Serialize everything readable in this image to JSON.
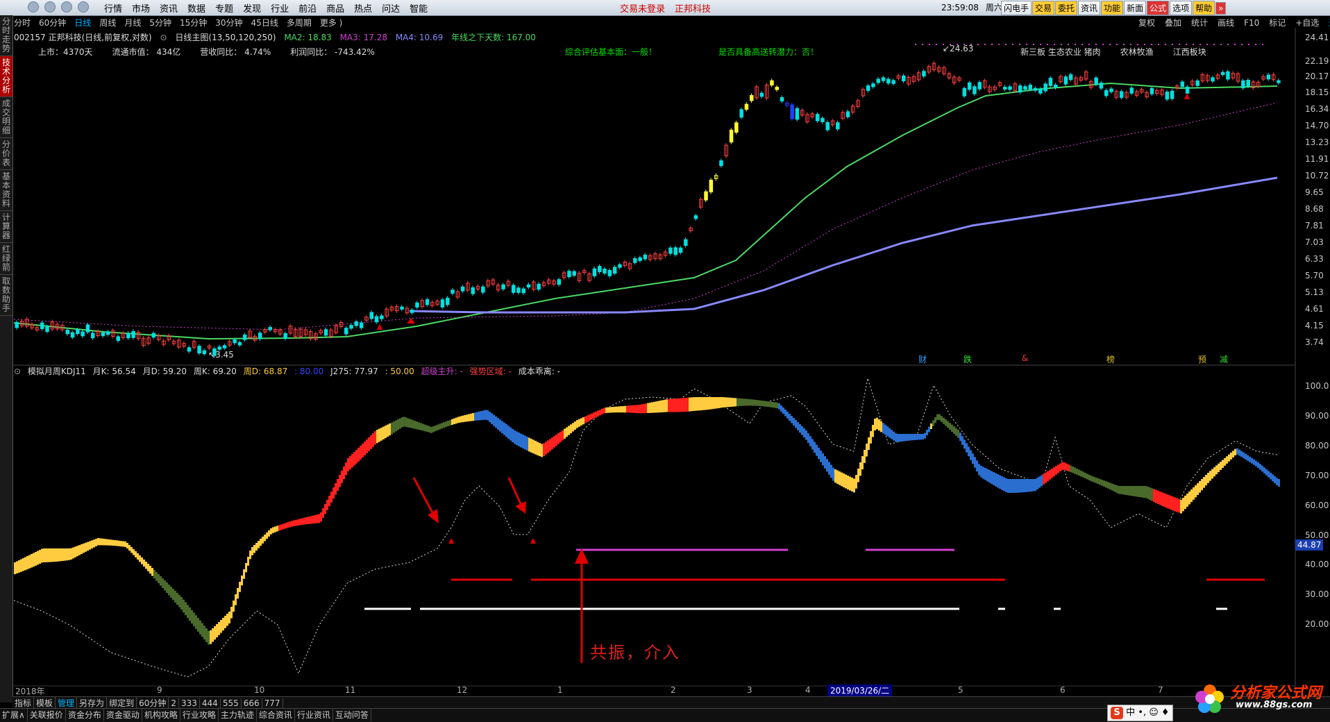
{
  "menu": [
    "行情",
    "市场",
    "资讯",
    "数据",
    "专题",
    "发现",
    "行业",
    "前沿",
    "商品",
    "热点",
    "问达",
    "智能"
  ],
  "status": {
    "trade": "交易未登录",
    "stock": "正邦科技"
  },
  "clock": {
    "time": "23:59:08",
    "weekday": "周六"
  },
  "top_buttons": [
    "闪电手",
    "交易",
    "委托",
    "资讯",
    "功能",
    "新面",
    "公式",
    "选项",
    "帮助"
  ],
  "side_tabs": [
    "分时走势",
    "技术分析",
    "成交明细",
    "分价表",
    "基本资料",
    "计算器",
    "红绿箭",
    "取数助手"
  ],
  "periods": [
    "分时",
    "60分钟",
    "日线",
    "周线",
    "月线",
    "5分钟",
    "15分钟",
    "30分钟",
    "45日线",
    "多周期",
    "更多 )"
  ],
  "active_period": "日线",
  "right_tools": [
    "复权",
    "叠加",
    "统计",
    "画线",
    "F10",
    "标记",
    "+自选",
    "返回"
  ],
  "info": {
    "code_name": "002157 正邦科技(日线,前复权,对数)",
    "main_chart": "日线主图(13,50,120,250)",
    "ma2": "MA2: 18.83",
    "ma3": "MA3: 17.28",
    "ma4": "MA4: 10.69",
    "year_line": "年线之下天数: 167.00"
  },
  "stats": [
    "上市：4370天",
    "流通市值：   434亿",
    "营收同比：   4.74%",
    "利润同比：   -743.42%"
  ],
  "evaluation": {
    "basic": "综合评估基本面：一般！",
    "potential": "是否具备高送转潜力：否！"
  },
  "sectors": [
    "新三板 生态农业 猪肉",
    "农林牧渔",
    "江西板块"
  ],
  "price_axis": [
    "24.41",
    "22.19",
    "20.17",
    "18.15",
    "16.34",
    "14.70",
    "13.23",
    "11.91",
    "10.72",
    "9.65",
    "8.68",
    "7.81",
    "7.03",
    "6.33",
    "5.70",
    "5.13",
    "4.61",
    "4.15",
    "3.74"
  ],
  "price_labels": {
    "high": "24.63",
    "low": "3.45"
  },
  "event_labels": [
    {
      "text": "财",
      "color": "#3aa0ff"
    },
    {
      "text": "跌",
      "color": "#30e030"
    },
    {
      "text": "&",
      "color": "#ff3030"
    },
    {
      "text": "榜",
      "color": "#e0c020"
    },
    {
      "text": "预",
      "color": "#e0c020"
    },
    {
      "text": "减",
      "color": "#30e030"
    }
  ],
  "kdj": {
    "name": "模拟月周KDJ11",
    "monthK": "月K: 56.54",
    "monthD": "月D: 59.20",
    "weekK": "周K: 69.20",
    "weekD": "周D: 68.87",
    "v80": ": 80.00",
    "j275": "J275: 77.97",
    "v50": ": 50.00",
    "super": "超级主升: -",
    "strong": "强势区域: -",
    "cost": "成本乖离: -"
  },
  "kdj_axis": [
    "100.0",
    "90.00",
    "80.00",
    "70.00",
    "60.00",
    "50.00",
    "40.00",
    "30.00",
    "20.00"
  ],
  "current_value": "44.87",
  "x_axis": [
    "2018年",
    "9",
    "10",
    "11",
    "12",
    "1",
    "2",
    "3",
    "4",
    "5",
    "6",
    "7"
  ],
  "highlight_date": "2019/03/26/二",
  "annotation": "共振，介入",
  "bottom_tabs1": [
    "指标",
    "模板",
    "管理",
    "另存为",
    "绑定到",
    "60分钟",
    "2",
    "333",
    "444",
    "555",
    "666",
    "777"
  ],
  "bottom_tabs2": [
    "扩展∧",
    "关联报价",
    "资金分布",
    "资金驱动",
    "机构攻略",
    "行业攻略",
    "主力轨迹",
    "综合资讯",
    "行业资讯",
    "互动问答"
  ],
  "logo": {
    "text": "分析家公式网",
    "url": "www.88gs.com"
  },
  "ime": "中 •, ☺ ♦",
  "colors": {
    "up": "#ff3030",
    "down": "#00e0e0",
    "ma_green": "#4cd964",
    "ma_purple": "#8888ff",
    "ma_dash": "#d040d0"
  }
}
